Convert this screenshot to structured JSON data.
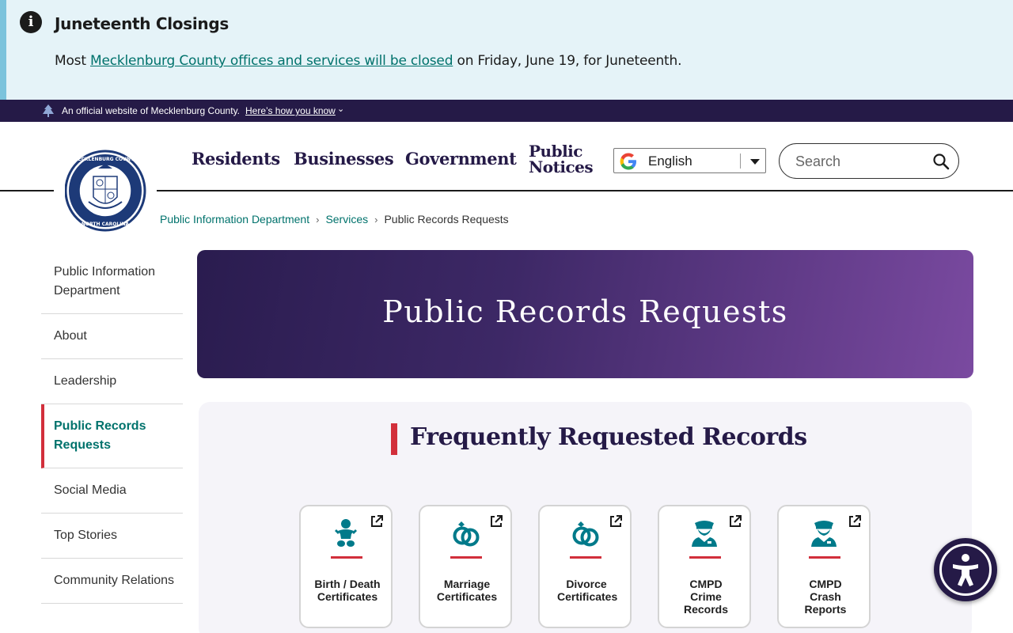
{
  "alert": {
    "title": "Juneteenth Closings",
    "text_before": "Most ",
    "link": "Mecklenburg County offices and services will be closed",
    "text_after": " on Friday, June 19, for Juneteenth."
  },
  "official_banner": {
    "text": "An official website of Mecklenburg County.",
    "link": "Here’s how you know"
  },
  "nav": {
    "residents": "Residents",
    "businesses": "Businesses",
    "government": "Government",
    "public_notices_line1": "Public",
    "public_notices_line2": "Notices"
  },
  "language": {
    "selected": "English"
  },
  "search": {
    "placeholder": "Search"
  },
  "breadcrumb": {
    "items": [
      "Public Information Department",
      "Services"
    ],
    "current": "Public Records Requests"
  },
  "sidebar": {
    "items": [
      {
        "label": "Public Information Department"
      },
      {
        "label": "About"
      },
      {
        "label": "Leadership"
      },
      {
        "label": "Public Records Requests"
      },
      {
        "label": "Social Media"
      },
      {
        "label": "Top Stories"
      },
      {
        "label": "Community Relations"
      }
    ]
  },
  "hero": {
    "title": "Public Records Requests"
  },
  "frequent": {
    "title": "Frequently Requested Records",
    "cards": [
      {
        "label": "Birth / Death Certificates",
        "icon": "baby-icon"
      },
      {
        "label": "Marriage Certificates",
        "icon": "rings-icon"
      },
      {
        "label": "Divorce Certificates",
        "icon": "rings-icon"
      },
      {
        "label": "CMPD Crime Records",
        "icon": "police-officer-icon"
      },
      {
        "label": "CMPD Crash Reports",
        "icon": "police-officer-icon"
      }
    ]
  },
  "colors": {
    "brand_purple": "#251a47",
    "accent_red": "#d22f3b",
    "link_teal": "#00726c",
    "icon_teal": "#007a8a"
  }
}
